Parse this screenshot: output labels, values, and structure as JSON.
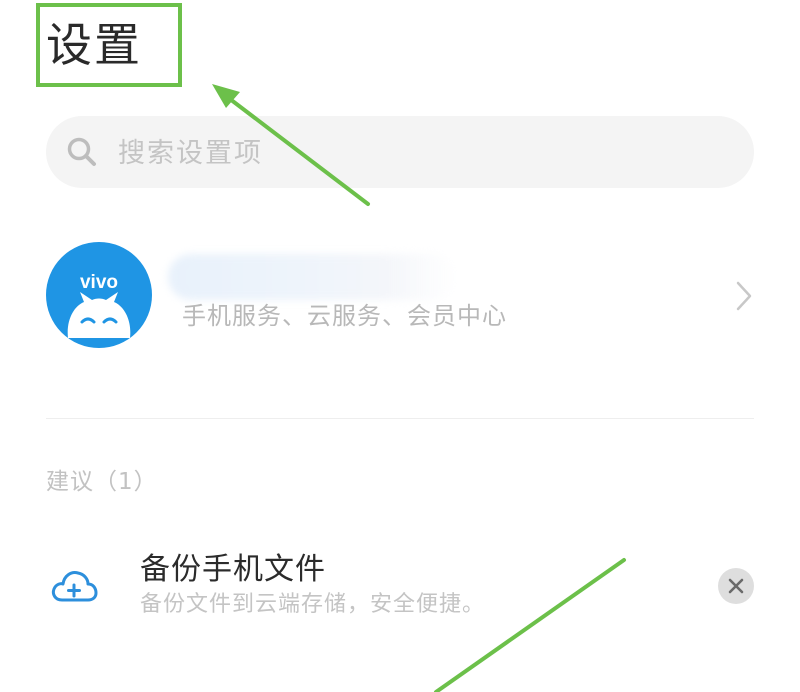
{
  "header": {
    "title": "设置"
  },
  "search": {
    "placeholder": "搜索设置项",
    "value": ""
  },
  "account": {
    "avatar_logo_text": "vivo",
    "subtitle": "手机服务、云服务、会员中心",
    "name_blurred": true
  },
  "suggestions": {
    "header": "建议（1）",
    "items": [
      {
        "title": "备份手机文件",
        "description": "备份文件到云端存储，安全便捷。",
        "icon": "cloud-add-icon"
      }
    ]
  },
  "colors": {
    "annotation_green": "#6cc04a",
    "vivo_blue": "#1f95e4",
    "background": "#ffffff",
    "search_bg": "#f4f4f4"
  },
  "icons": {
    "search": "search-icon",
    "chevron": "chevron-right-icon",
    "dismiss": "close-icon",
    "avatar": "vivo-logo-icon"
  }
}
